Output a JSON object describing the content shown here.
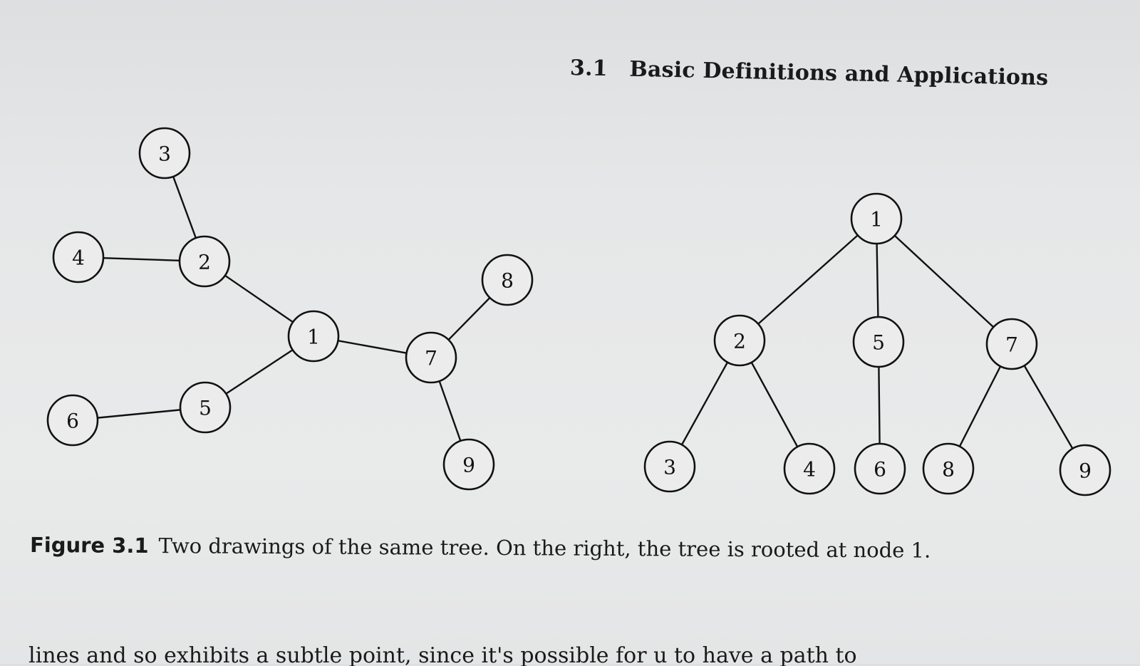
{
  "header": {
    "section_number": "3.1",
    "section_title": "Basic Definitions and Applications"
  },
  "figure": {
    "left_tree": {
      "nodes": [
        "1",
        "2",
        "3",
        "4",
        "5",
        "6",
        "7",
        "8",
        "9"
      ],
      "edges": [
        [
          "3",
          "2"
        ],
        [
          "4",
          "2"
        ],
        [
          "2",
          "1"
        ],
        [
          "1",
          "7"
        ],
        [
          "1",
          "5"
        ],
        [
          "5",
          "6"
        ],
        [
          "7",
          "8"
        ],
        [
          "7",
          "9"
        ]
      ]
    },
    "right_tree": {
      "root": "1",
      "nodes": [
        "1",
        "2",
        "3",
        "4",
        "5",
        "6",
        "7",
        "8",
        "9"
      ],
      "edges": [
        [
          "1",
          "2"
        ],
        [
          "1",
          "5"
        ],
        [
          "1",
          "7"
        ],
        [
          "2",
          "3"
        ],
        [
          "2",
          "4"
        ],
        [
          "5",
          "6"
        ],
        [
          "7",
          "8"
        ],
        [
          "7",
          "9"
        ]
      ]
    }
  },
  "caption": {
    "label": "Figure 3.1",
    "text": "Two drawings of the same tree. On the right, the tree is rooted at node 1."
  },
  "body_text_fragment": "lines and so exhibits a subtle point, since it's possible for u to have a path to"
}
